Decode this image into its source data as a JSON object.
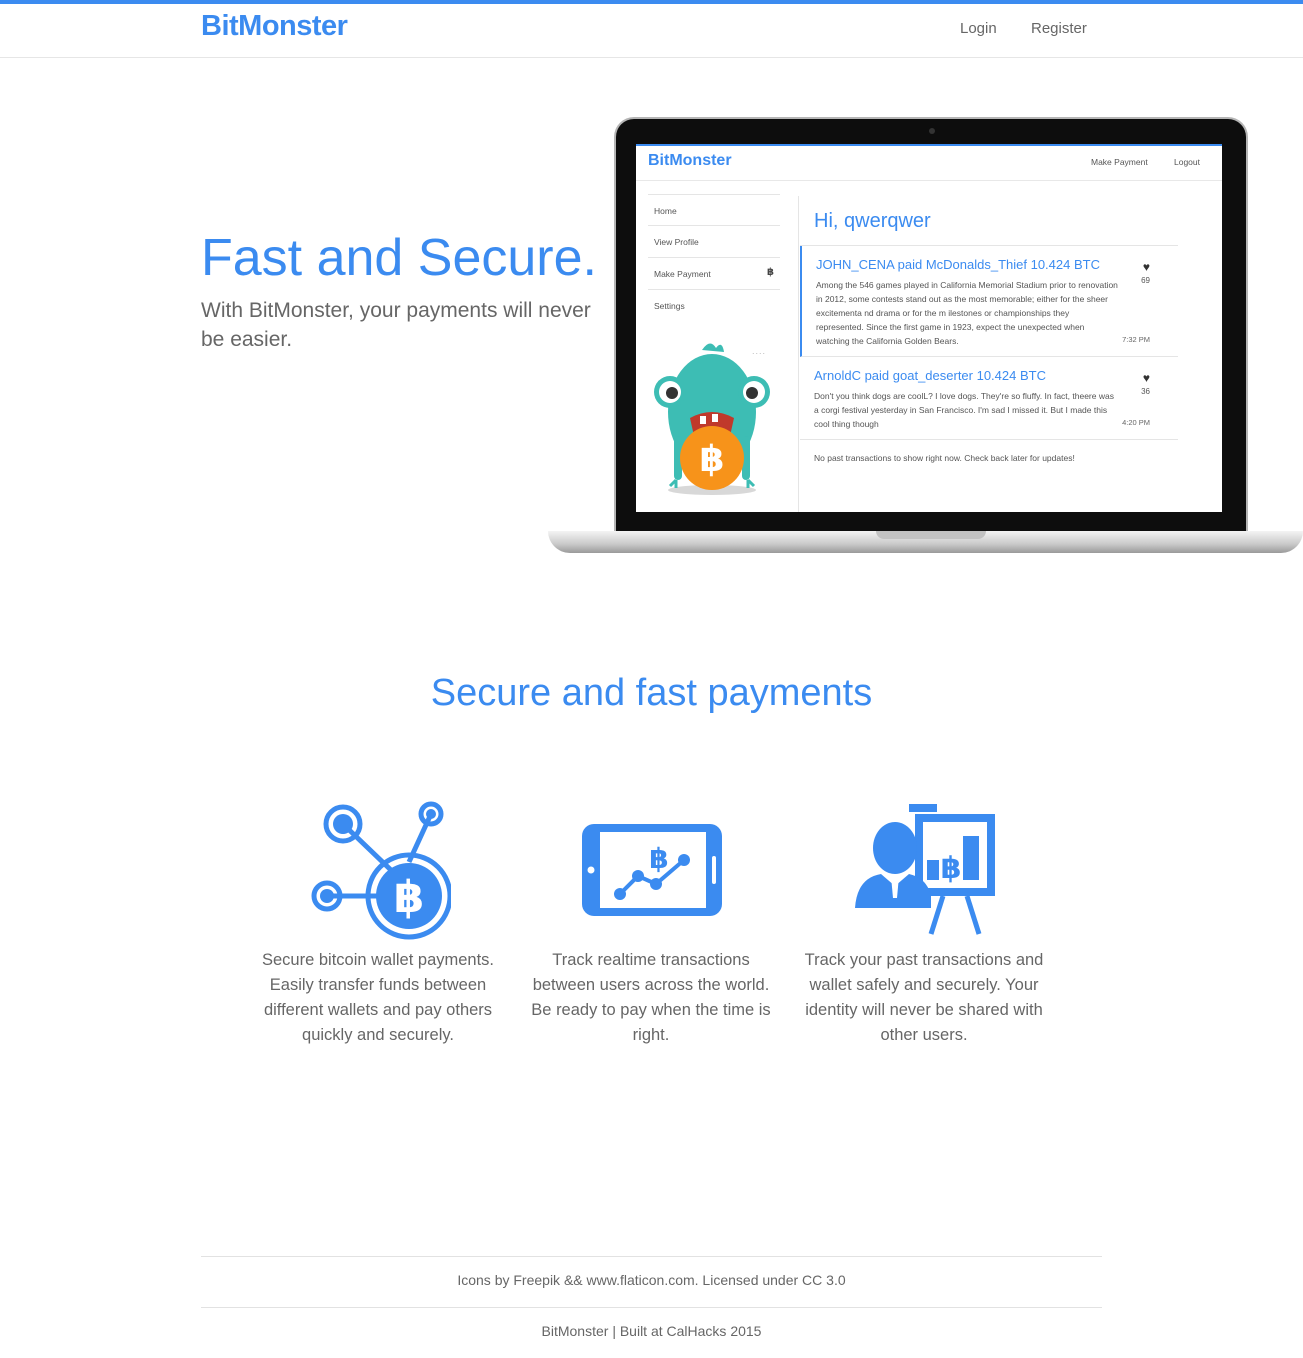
{
  "header": {
    "brand": "BitMonster",
    "nav": {
      "login": "Login",
      "register": "Register"
    }
  },
  "hero": {
    "title": "Fast and Secure.",
    "subtitle": "With BitMonster, your payments will never be easier."
  },
  "mockup": {
    "brand": "BitMonster",
    "nav": {
      "make_payment": "Make Payment",
      "logout": "Logout"
    },
    "menu": [
      "Home",
      "View Profile",
      "Make Payment",
      "Settings"
    ],
    "greeting": "Hi, qwerqwer",
    "posts": [
      {
        "title": "JOHN_CENA paid McDonalds_Thief 10.424 BTC",
        "body": "Among the 546 games played in California Memorial Stadium prior to renovation in 2012, some contests stand out as the most memorable; either for the sheer excitementa nd drama or for the m ilestones or championships they represented. Since the first game in 1923, expect the unexpected when watching the California Golden Bears.",
        "likes": "69",
        "time": "7:32 PM"
      },
      {
        "title": "ArnoldC paid goat_deserter 10.424 BTC",
        "body": "Don't you think dogs are coolL? I love dogs. They're so fluffy. In fact, theere was a corgi festival yesterday in San Francisco. I'm sad I missed it. But I made this cool thing though",
        "likes": "36",
        "time": "4:20 PM"
      }
    ],
    "empty_note": "No past transactions to show right now. Check back later for updates!"
  },
  "features": {
    "title": "Secure and fast payments",
    "items": [
      {
        "icon": "bitcoin-network-icon",
        "text": "Secure bitcoin wallet payments. Easily transfer funds between different wallets and pay others quickly and securely."
      },
      {
        "icon": "tablet-chart-icon",
        "text": "Track realtime transactions between users across the world. Be ready to pay when the time is right."
      },
      {
        "icon": "presentation-icon",
        "text": "Track your past transactions and wallet safely and securely. Your identity will never be shared with other users."
      }
    ]
  },
  "footer": {
    "credits": "Icons by Freepik && www.flaticon.com. Licensed under CC 3.0",
    "built": "BitMonster | Built at CalHacks 2015"
  },
  "colors": {
    "accent": "#3b8bf0",
    "bitcoin": "#f7931a",
    "monster": "#3dbdb4"
  }
}
